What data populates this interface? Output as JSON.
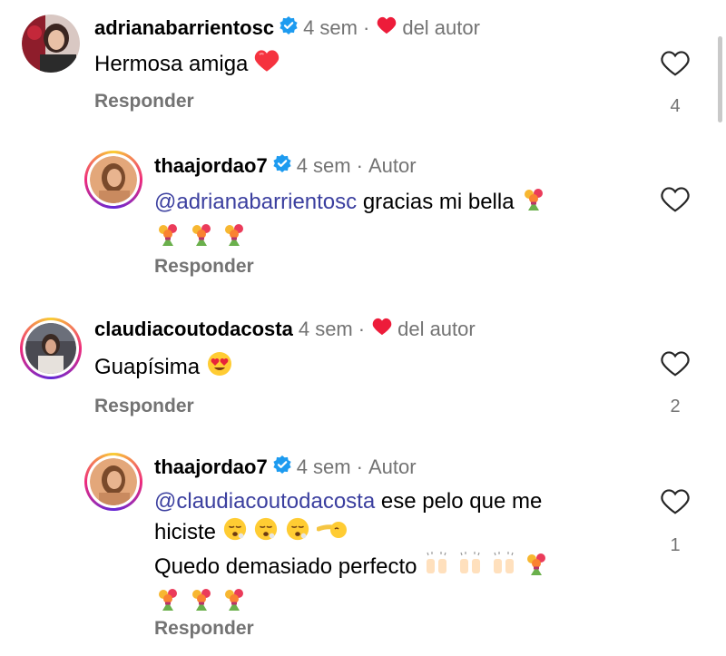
{
  "comments": [
    {
      "username": "adrianabarrientosc",
      "time": "4 sem",
      "author_badge": "del autor",
      "text": "Hermosa amiga",
      "emoji": [
        "red-heart"
      ],
      "reply_label": "Responder",
      "likes": "4"
    },
    {
      "username": "thaajordao7",
      "time": "4 sem",
      "author_badge": "Autor",
      "mention": "@adrianabarrientosc",
      "text": "gracias mi bella",
      "emoji": [
        "bouquet",
        "bouquet",
        "bouquet",
        "bouquet"
      ],
      "reply_label": "Responder",
      "likes": ""
    },
    {
      "username": "claudiacoutodacosta",
      "time": "4 sem",
      "author_badge": "del autor",
      "text": "Guapísima",
      "emoji": [
        "heart-eyes"
      ],
      "reply_label": "Responder",
      "likes": "2"
    },
    {
      "username": "thaajordao7",
      "time": "4 sem",
      "author_badge": "Autor",
      "mention": "@claudiacoutodacosta",
      "text_line1": "ese pelo que me",
      "text_line2": "hiciste",
      "text_line3": "Quedo demasiado perfecto",
      "emoji": [
        "exhaling-face",
        "exhaling-face",
        "exhaling-face",
        "pointing-hand",
        "raised-hands",
        "raised-hands",
        "raised-hands",
        "bouquet",
        "bouquet",
        "bouquet",
        "bouquet"
      ],
      "reply_label": "Responder",
      "likes": "1"
    }
  ],
  "colors": {
    "mention": "#3b3f9f",
    "secondary_text": "#737373",
    "heart": "#ed1c3a",
    "verified": "#1d9bf0"
  }
}
